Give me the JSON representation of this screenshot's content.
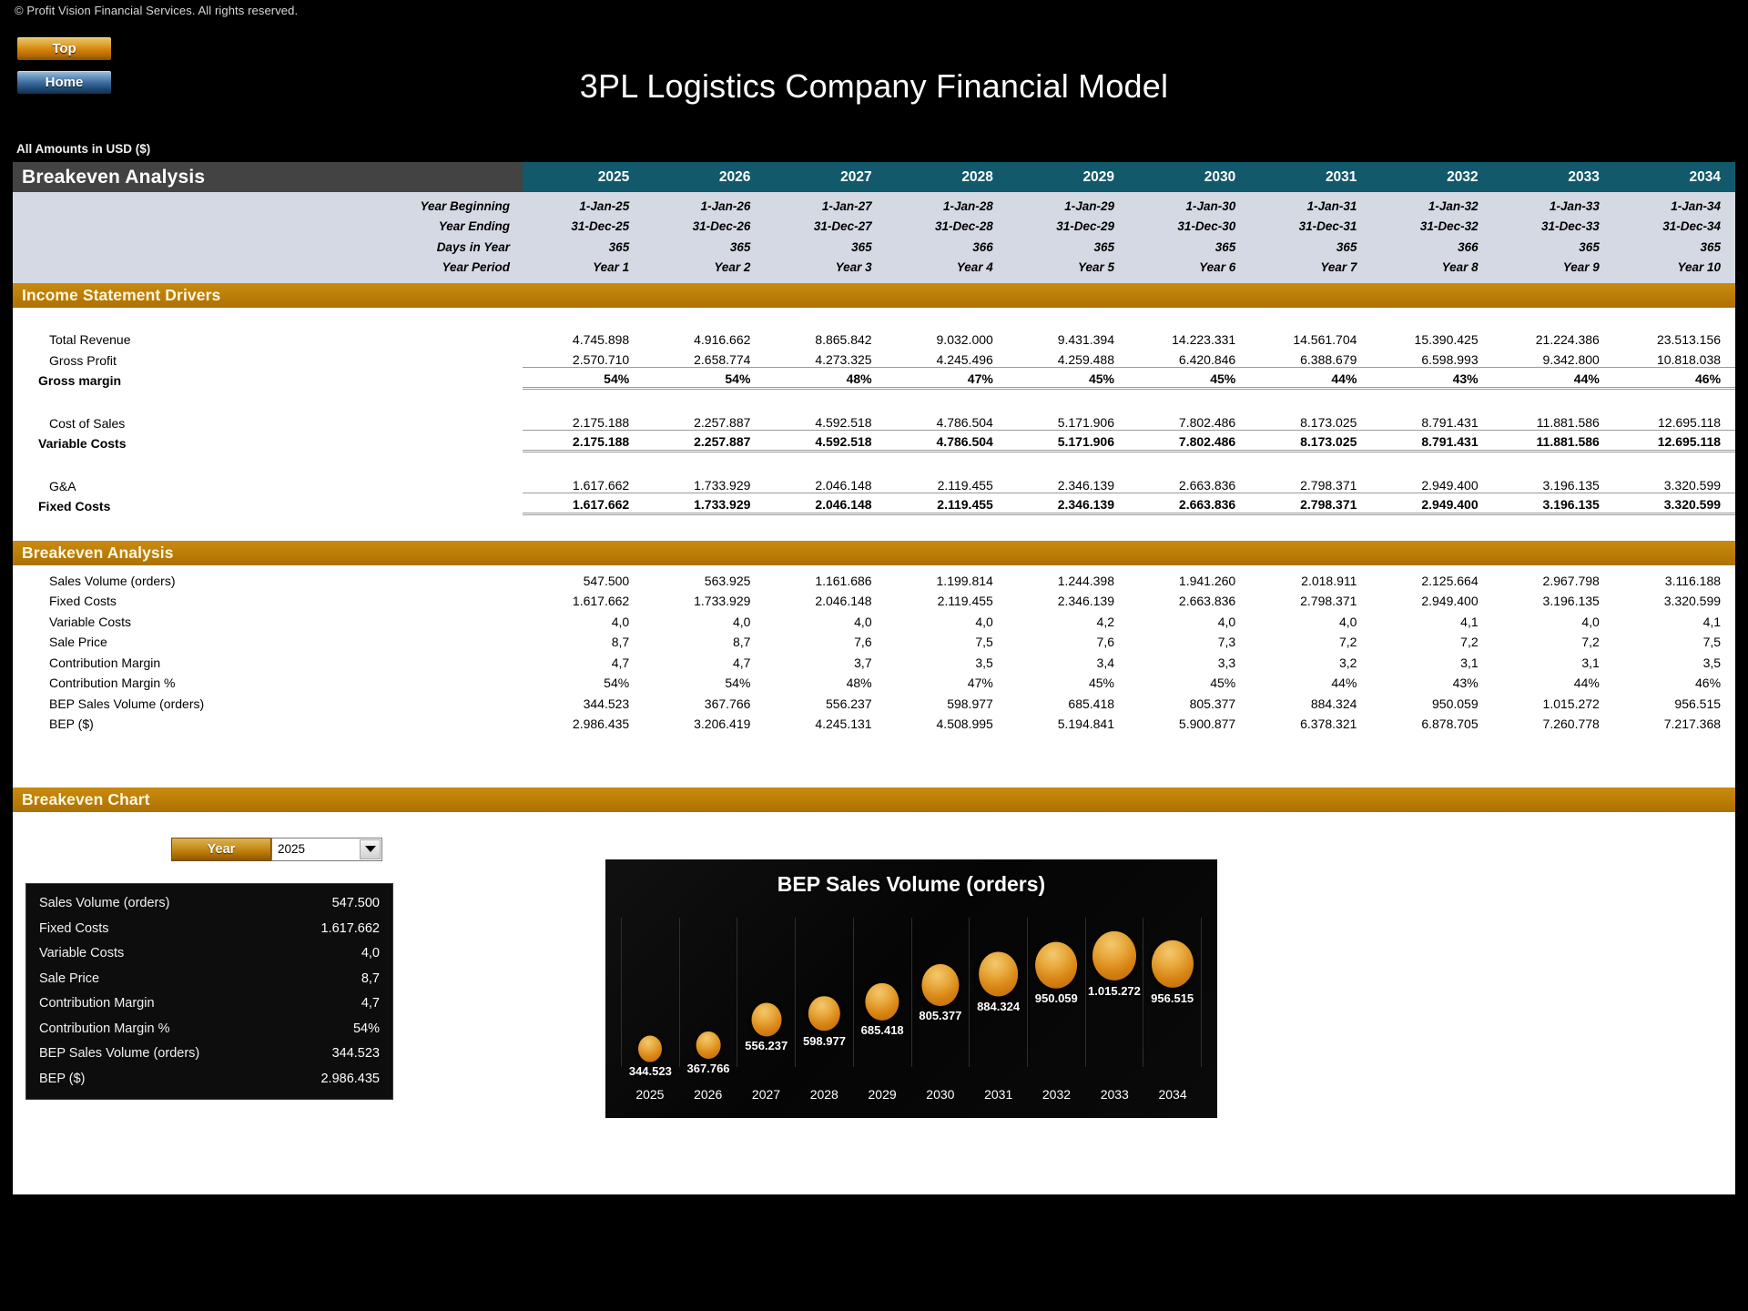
{
  "copyright": "© Profit Vision Financial Services. All rights reserved.",
  "nav": {
    "top_label": "Top",
    "home_label": "Home"
  },
  "header": {
    "title": "3PL Logistics Company Financial Model",
    "amounts_note": "All Amounts in  USD ($)"
  },
  "sheet": {
    "section_title": "Breakeven Analysis",
    "years": [
      "2025",
      "2026",
      "2027",
      "2028",
      "2029",
      "2030",
      "2031",
      "2032",
      "2033",
      "2034"
    ],
    "date_rows": [
      {
        "label": "Year Beginning",
        "values": [
          "1-Jan-25",
          "1-Jan-26",
          "1-Jan-27",
          "1-Jan-28",
          "1-Jan-29",
          "1-Jan-30",
          "1-Jan-31",
          "1-Jan-32",
          "1-Jan-33",
          "1-Jan-34"
        ]
      },
      {
        "label": "Year Ending",
        "values": [
          "31-Dec-25",
          "31-Dec-26",
          "31-Dec-27",
          "31-Dec-28",
          "31-Dec-29",
          "31-Dec-30",
          "31-Dec-31",
          "31-Dec-32",
          "31-Dec-33",
          "31-Dec-34"
        ]
      },
      {
        "label": "Days in Year",
        "values": [
          "365",
          "365",
          "365",
          "366",
          "365",
          "365",
          "365",
          "366",
          "365",
          "365"
        ]
      },
      {
        "label": "Year Period",
        "values": [
          "Year 1",
          "Year 2",
          "Year 3",
          "Year 4",
          "Year 5",
          "Year 6",
          "Year 7",
          "Year 8",
          "Year 9",
          "Year 10"
        ]
      }
    ],
    "band_income": "Income Statement Drivers",
    "income_rows": [
      {
        "label": "Total Revenue",
        "values": [
          "4.745.898",
          "4.916.662",
          "8.865.842",
          "9.032.000",
          "9.431.394",
          "14.223.331",
          "14.561.704",
          "15.390.425",
          "21.224.386",
          "23.513.156"
        ]
      },
      {
        "label": "Gross Profit",
        "values": [
          "2.570.710",
          "2.658.774",
          "4.273.325",
          "4.245.496",
          "4.259.488",
          "6.420.846",
          "6.388.679",
          "6.598.993",
          "9.342.800",
          "10.818.038"
        ]
      },
      {
        "label": "Gross margin",
        "values": [
          "54%",
          "54%",
          "48%",
          "47%",
          "45%",
          "45%",
          "44%",
          "43%",
          "44%",
          "46%"
        ]
      },
      {
        "label": "Cost of Sales",
        "values": [
          "2.175.188",
          "2.257.887",
          "4.592.518",
          "4.786.504",
          "5.171.906",
          "7.802.486",
          "8.173.025",
          "8.791.431",
          "11.881.586",
          "12.695.118"
        ]
      },
      {
        "label": "Variable Costs",
        "values": [
          "2.175.188",
          "2.257.887",
          "4.592.518",
          "4.786.504",
          "5.171.906",
          "7.802.486",
          "8.173.025",
          "8.791.431",
          "11.881.586",
          "12.695.118"
        ]
      },
      {
        "label": "G&A",
        "values": [
          "1.617.662",
          "1.733.929",
          "2.046.148",
          "2.119.455",
          "2.346.139",
          "2.663.836",
          "2.798.371",
          "2.949.400",
          "3.196.135",
          "3.320.599"
        ]
      },
      {
        "label": "Fixed Costs",
        "values": [
          "1.617.662",
          "1.733.929",
          "2.046.148",
          "2.119.455",
          "2.346.139",
          "2.663.836",
          "2.798.371",
          "2.949.400",
          "3.196.135",
          "3.320.599"
        ]
      }
    ],
    "band_breakeven": "Breakeven Analysis",
    "breakeven_rows": [
      {
        "label": "Sales Volume (orders)",
        "values": [
          "547.500",
          "563.925",
          "1.161.686",
          "1.199.814",
          "1.244.398",
          "1.941.260",
          "2.018.911",
          "2.125.664",
          "2.967.798",
          "3.116.188"
        ]
      },
      {
        "label": "Fixed Costs",
        "values": [
          "1.617.662",
          "1.733.929",
          "2.046.148",
          "2.119.455",
          "2.346.139",
          "2.663.836",
          "2.798.371",
          "2.949.400",
          "3.196.135",
          "3.320.599"
        ]
      },
      {
        "label": "Variable Costs",
        "values": [
          "4,0",
          "4,0",
          "4,0",
          "4,0",
          "4,2",
          "4,0",
          "4,0",
          "4,1",
          "4,0",
          "4,1"
        ]
      },
      {
        "label": "Sale Price",
        "values": [
          "8,7",
          "8,7",
          "7,6",
          "7,5",
          "7,6",
          "7,3",
          "7,2",
          "7,2",
          "7,2",
          "7,5"
        ]
      },
      {
        "label": "Contribution Margin",
        "values": [
          "4,7",
          "4,7",
          "3,7",
          "3,5",
          "3,4",
          "3,3",
          "3,2",
          "3,1",
          "3,1",
          "3,5"
        ]
      },
      {
        "label": "Contribution Margin %",
        "values": [
          "54%",
          "54%",
          "48%",
          "47%",
          "45%",
          "45%",
          "44%",
          "43%",
          "44%",
          "46%"
        ]
      },
      {
        "label": "BEP Sales Volume (orders)",
        "values": [
          "344.523",
          "367.766",
          "556.237",
          "598.977",
          "685.418",
          "805.377",
          "884.324",
          "950.059",
          "1.015.272",
          "956.515"
        ]
      },
      {
        "label": "BEP ($)",
        "values": [
          "2.986.435",
          "3.206.419",
          "4.245.131",
          "4.508.995",
          "5.194.841",
          "5.900.877",
          "6.378.321",
          "6.878.705",
          "7.260.778",
          "7.217.368"
        ]
      }
    ],
    "band_chart": "Breakeven Chart"
  },
  "chart_section": {
    "year_button_label": "Year",
    "year_selected": "2025",
    "year_options": [
      "2025",
      "2026",
      "2027",
      "2028",
      "2029",
      "2030",
      "2031",
      "2032",
      "2033",
      "2034"
    ],
    "summary": [
      {
        "label": "Sales Volume (orders)",
        "value": "547.500"
      },
      {
        "label": "Fixed Costs",
        "value": "1.617.662"
      },
      {
        "label": "Variable Costs",
        "value": "4,0"
      },
      {
        "label": "Sale Price",
        "value": "8,7"
      },
      {
        "label": "Contribution Margin",
        "value": "4,7"
      },
      {
        "label": "Contribution Margin %",
        "value": "54%"
      },
      {
        "label": "BEP Sales Volume (orders)",
        "value": "344.523"
      },
      {
        "label": "BEP ($)",
        "value": "2.986.435"
      }
    ]
  },
  "chart_data": {
    "type": "scatter",
    "title": "BEP Sales Volume (orders)",
    "xlabel": "",
    "ylabel": "",
    "categories": [
      "2025",
      "2026",
      "2027",
      "2028",
      "2029",
      "2030",
      "2031",
      "2032",
      "2033",
      "2034"
    ],
    "values": [
      344523,
      367766,
      556237,
      598977,
      685418,
      805377,
      884324,
      950059,
      1015272,
      956515
    ],
    "labels": [
      "344.523",
      "367.766",
      "556.237",
      "598.977",
      "685.418",
      "805.377",
      "884.324",
      "950.059",
      "1.015.272",
      "956.515"
    ],
    "ylim": [
      0,
      1100000
    ],
    "grid": false,
    "legend": false,
    "bubble_color": "#e0931f",
    "background": "#0a0a0a"
  },
  "colors": {
    "accent_orange": "#bd7f07",
    "header_teal": "#11596b",
    "header_grey": "#434343",
    "date_band": "#d5d9e3",
    "panel_black": "#0d0d0d"
  }
}
